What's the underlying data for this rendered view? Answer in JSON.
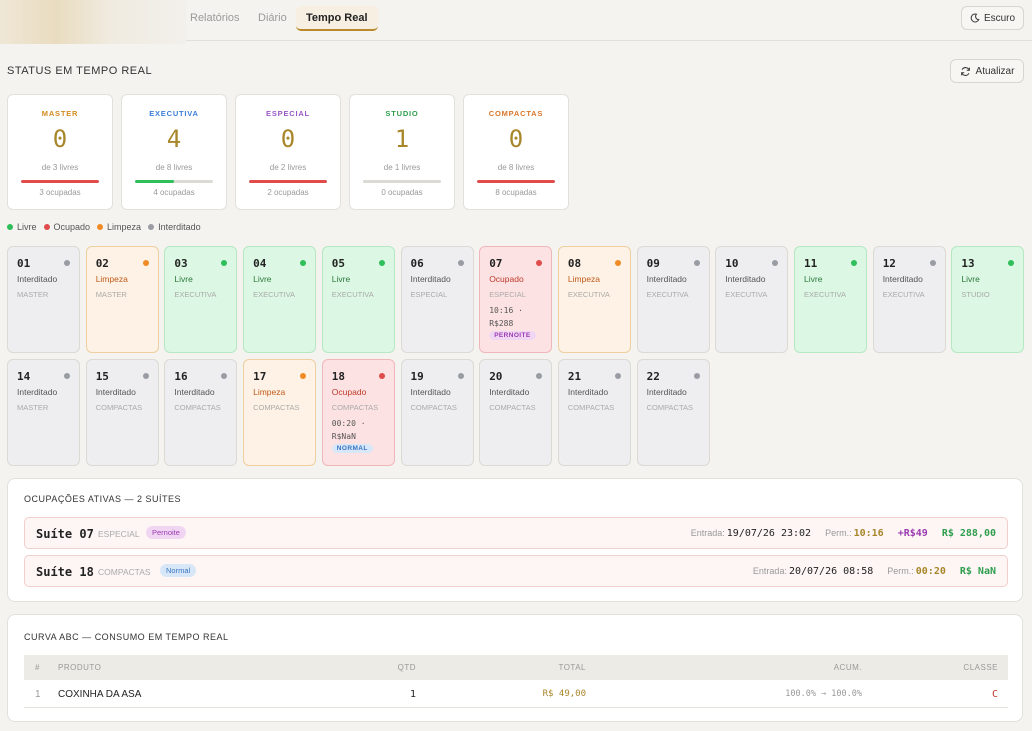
{
  "nav": {
    "tabs": [
      {
        "label": "Relatórios"
      },
      {
        "label": "Diário"
      },
      {
        "label": "Tempo Real"
      }
    ],
    "theme_label": "Escuro"
  },
  "status": {
    "title": "STATUS EM TEMPO REAL",
    "refresh_label": "Atualizar"
  },
  "categories": [
    {
      "name": "MASTER",
      "count": "0",
      "sub": "de 3 livres",
      "occupied": "3 ocupadas",
      "free_ratio": 0,
      "name_color": "#d48a1e",
      "bar_color": "#e04b4b"
    },
    {
      "name": "EXECUTIVA",
      "count": "4",
      "sub": "de 8 livres",
      "occupied": "4 ocupadas",
      "free_ratio": 0.5,
      "name_color": "#3b7fd9",
      "bar_color": "#2fbf5a"
    },
    {
      "name": "ESPECIAL",
      "count": "0",
      "sub": "de 2 livres",
      "occupied": "2 ocupadas",
      "free_ratio": 0,
      "name_color": "#9b59c6",
      "bar_color": "#e04b4b"
    },
    {
      "name": "STUDIO",
      "count": "1",
      "sub": "de 1 livres",
      "occupied": "0 ocupadas",
      "free_ratio": 1,
      "name_color": "#2f9e4e",
      "bar_color": "#dcdad5"
    },
    {
      "name": "COMPACTAS",
      "count": "0",
      "sub": "de 8 livres",
      "occupied": "8 ocupadas",
      "free_ratio": 0,
      "name_color": "#d9762a",
      "bar_color": "#e04b4b"
    }
  ],
  "legend": [
    {
      "label": "Livre",
      "color": "#2fbf5a"
    },
    {
      "label": "Ocupado",
      "color": "#e04b4b"
    },
    {
      "label": "Limpeza",
      "color": "#f08a24"
    },
    {
      "label": "Interditado",
      "color": "#9a9ca3"
    }
  ],
  "suites": [
    {
      "num": "01",
      "status": "Interditado",
      "cat": "MASTER",
      "state": "int"
    },
    {
      "num": "02",
      "status": "Limpeza",
      "cat": "MASTER",
      "state": "limp"
    },
    {
      "num": "03",
      "status": "Livre",
      "cat": "EXECUTIVA",
      "state": "livre"
    },
    {
      "num": "04",
      "status": "Livre",
      "cat": "EXECUTIVA",
      "state": "livre"
    },
    {
      "num": "05",
      "status": "Livre",
      "cat": "EXECUTIVA",
      "state": "livre"
    },
    {
      "num": "06",
      "status": "Interditado",
      "cat": "ESPECIAL",
      "state": "int"
    },
    {
      "num": "07",
      "status": "Ocupado",
      "cat": "ESPECIAL",
      "state": "ocup",
      "time": "10:16 · R$288",
      "tag": "PERNOITE"
    },
    {
      "num": "08",
      "status": "Limpeza",
      "cat": "EXECUTIVA",
      "state": "limp"
    },
    {
      "num": "09",
      "status": "Interditado",
      "cat": "EXECUTIVA",
      "state": "int"
    },
    {
      "num": "10",
      "status": "Interditado",
      "cat": "EXECUTIVA",
      "state": "int"
    },
    {
      "num": "11",
      "status": "Livre",
      "cat": "EXECUTIVA",
      "state": "livre"
    },
    {
      "num": "12",
      "status": "Interditado",
      "cat": "EXECUTIVA",
      "state": "int"
    },
    {
      "num": "13",
      "status": "Livre",
      "cat": "STUDIO",
      "state": "livre"
    },
    {
      "num": "14",
      "status": "Interditado",
      "cat": "MASTER",
      "state": "int"
    },
    {
      "num": "15",
      "status": "Interditado",
      "cat": "COMPACTAS",
      "state": "int"
    },
    {
      "num": "16",
      "status": "Interditado",
      "cat": "COMPACTAS",
      "state": "int"
    },
    {
      "num": "17",
      "status": "Limpeza",
      "cat": "COMPACTAS",
      "state": "limp"
    },
    {
      "num": "18",
      "status": "Ocupado",
      "cat": "COMPACTAS",
      "state": "ocup",
      "time": "00:20 · R$NaN",
      "tag": "NORMAL"
    },
    {
      "num": "19",
      "status": "Interditado",
      "cat": "COMPACTAS",
      "state": "int"
    },
    {
      "num": "20",
      "status": "Interditado",
      "cat": "COMPACTAS",
      "state": "int"
    },
    {
      "num": "21",
      "status": "Interditado",
      "cat": "COMPACTAS",
      "state": "int"
    },
    {
      "num": "22",
      "status": "Interditado",
      "cat": "COMPACTAS",
      "state": "int"
    }
  ],
  "occupations": {
    "title": "OCUPAÇÕES ATIVAS — 2 SUÍTES",
    "rows": [
      {
        "suite": "Suíte 07",
        "cat": "ESPECIAL",
        "tag": "Pernoite",
        "entrada_label": "Entrada:",
        "entrada": "19/07/26 23:02",
        "perm_label": "Perm.:",
        "perm": "10:16",
        "extra": "+R$49",
        "total": "R$ 288,00"
      },
      {
        "suite": "Suíte 18",
        "cat": "COMPACTAS",
        "tag": "Normal",
        "entrada_label": "Entrada:",
        "entrada": "20/07/26 08:58",
        "perm_label": "Perm.:",
        "perm": "00:20",
        "extra": "",
        "total": "R$ NaN"
      }
    ]
  },
  "abc": {
    "title": "CURVA ABC — CONSUMO EM TEMPO REAL",
    "headers": {
      "num": "#",
      "produto": "PRODUTO",
      "qtd": "QTD",
      "total": "TOTAL",
      "acum": "ACUM.",
      "classe": "CLASSE"
    },
    "rows": [
      {
        "num": "1",
        "produto": "COXINHA DA ASA",
        "qtd": "1",
        "total": "R$ 49,00",
        "acum": "100.0% → 100.0%",
        "classe": "C"
      }
    ]
  }
}
